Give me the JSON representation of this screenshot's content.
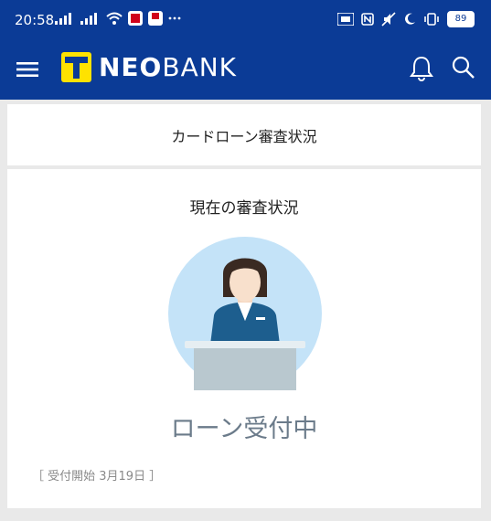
{
  "status_bar": {
    "time": "20:58",
    "battery": "89"
  },
  "header": {
    "logo_mark": "T",
    "logo_neo": "NEO",
    "logo_bank": "BANK",
    "brand_colors": {
      "primary": "#0b3b96",
      "accent": "#ffe200"
    }
  },
  "title_card": {
    "title": "カードローン審査状況"
  },
  "status_card": {
    "section_title": "現在の審査状況",
    "status": "ローン受付中",
    "start_date": "［ 受付開始 3月19日 ］"
  }
}
